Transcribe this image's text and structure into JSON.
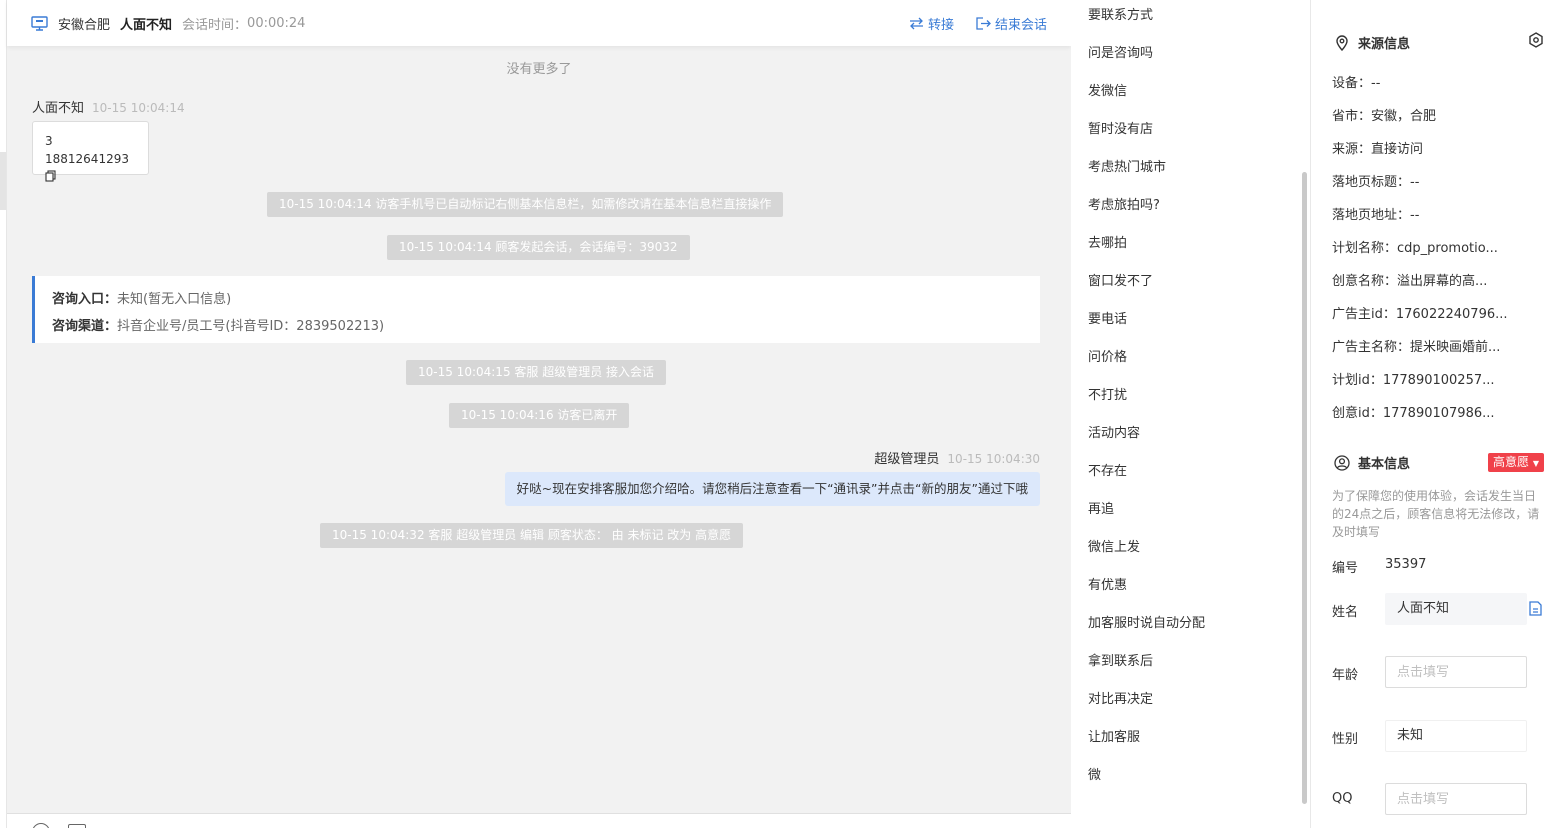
{
  "header": {
    "location": "安徽合肥",
    "visitor_name": "人面不知",
    "session_time_label": "会话时间：",
    "session_time": "00:00:24",
    "transfer_label": "转接",
    "end_label": "结束会话"
  },
  "chat": {
    "no_more": "没有更多了",
    "visitor_msg": {
      "name": "人面不知",
      "time": "10-15 10:04:14",
      "line1": "3",
      "line2": "18812641293"
    },
    "sys1": "10-15 10:04:14 访客手机号已自动标记右侧基本信息栏，如需修改请在基本信息栏直接操作",
    "sys2": "10-15 10:04:14 顾客发起会话，会话编号：39032",
    "entry_label": "咨询入口：",
    "entry_value": "未知(暂无入口信息)",
    "channel_label": "咨询渠道：",
    "channel_value": "抖音企业号/员工号(抖音号ID：2839502213)",
    "sys3": "10-15 10:04:15 客服 超级管理员 接入会话",
    "sys4": "10-15 10:04:16 访客已离开",
    "agent_name": "超级管理员",
    "agent_time": "10-15 10:04:30",
    "agent_msg": "好哒~现在安排客服加您介绍哈。请您稍后注意查看一下“通讯录”并点击“新的朋友”通过下哦",
    "sys5": "10-15 10:04:32 客服 超级管理员 编辑 顾客状态： 由 未标记 改为 高意愿"
  },
  "quick_replies": [
    "要联系方式",
    "问是咨询吗",
    "发微信",
    "暂时没有店",
    "考虑热门城市",
    "考虑旅拍吗?",
    "去哪拍",
    "窗口发不了",
    "要电话",
    "问价格",
    "不打扰",
    "活动内容",
    "不存在",
    "再追",
    "微信上发",
    "有优惠",
    "加客服时说自动分配",
    "拿到联系后",
    "对比再决定",
    "让加客服",
    "微"
  ],
  "source_info": {
    "title": "来源信息",
    "rows": [
      "设备：--",
      "省市：安徽，合肥",
      "来源：直接访问",
      "落地页标题：--",
      "落地页地址：--",
      "计划名称：cdp_promotio...",
      "创意名称：溢出屏幕的高...",
      "广告主id：176022240796...",
      "广告主名称：提米映画婚前...",
      "计划id：177890100257...",
      "创意id：177890107986..."
    ]
  },
  "basic_info": {
    "title": "基本信息",
    "intent_badge": "高意愿",
    "hint": "为了保障您的使用体验，会话发生当日的24点之后，顾客信息将无法修改，请及时填写",
    "id_label": "编号",
    "id_value": "35397",
    "name_label": "姓名",
    "name_value": "人面不知",
    "age_label": "年龄",
    "age_placeholder": "点击填写",
    "gender_label": "性别",
    "gender_value": "未知",
    "qq_label": "QQ",
    "qq_placeholder": "点击填写"
  },
  "colors": {
    "accent": "#3a7bd5",
    "badge": "#f0414a",
    "bubble": "#dce8fb",
    "system_pill": "#d6d6d6"
  }
}
